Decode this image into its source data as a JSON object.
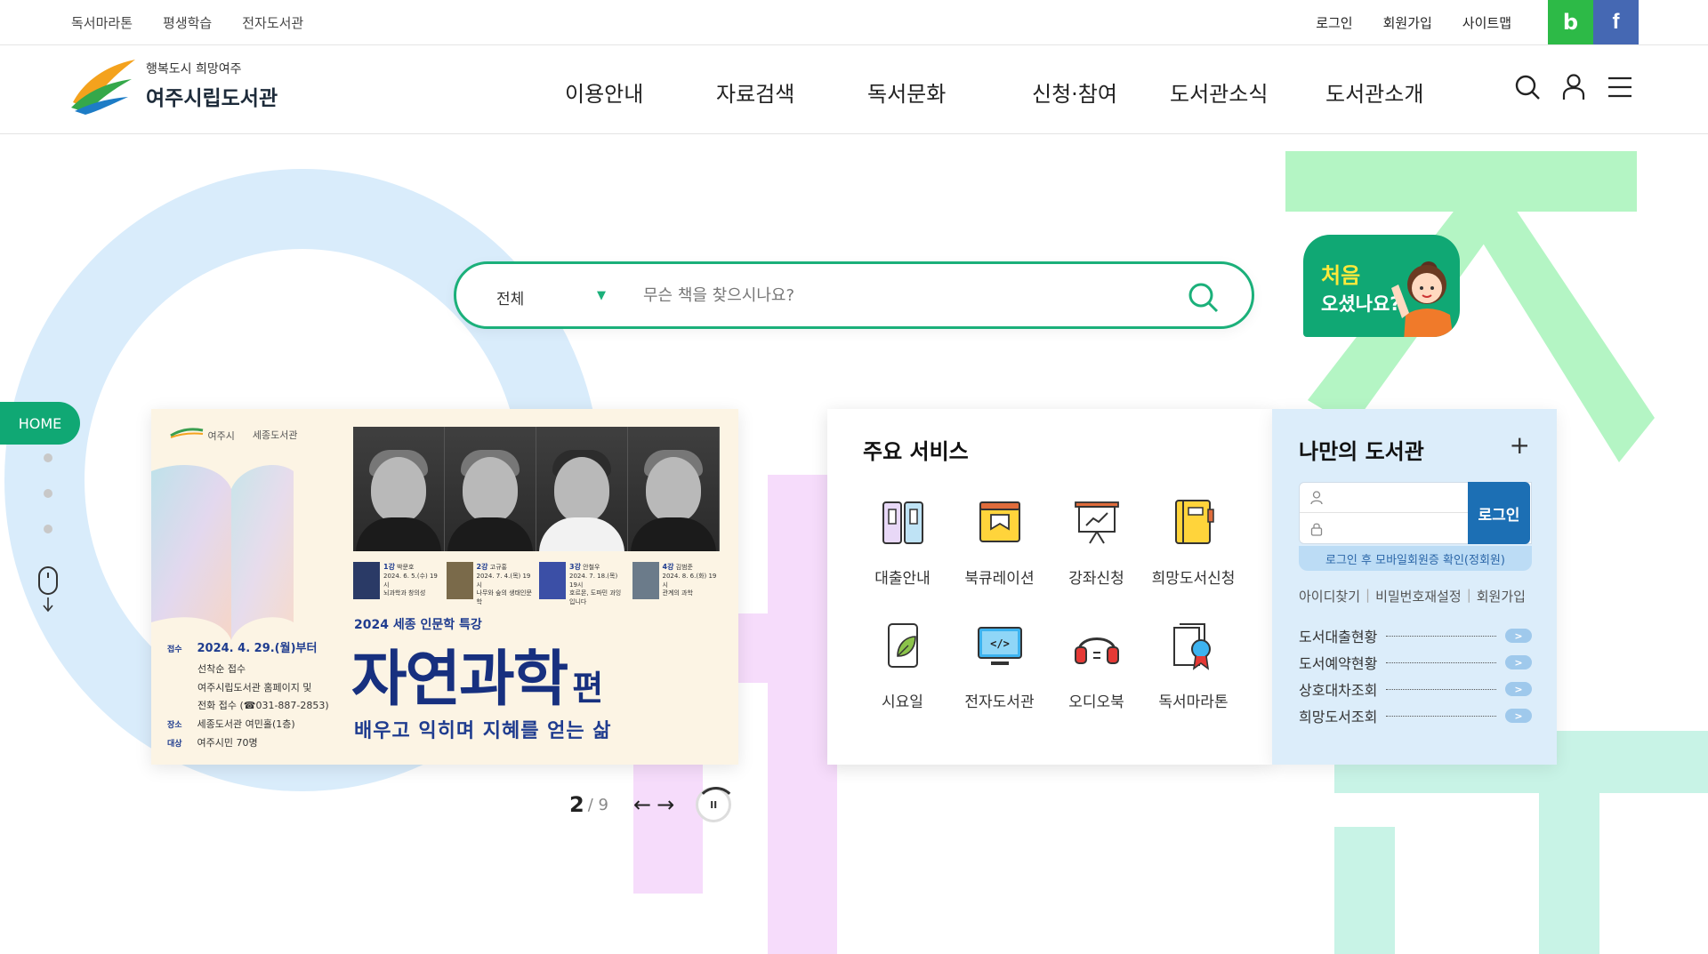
{
  "util": {
    "left_links": [
      "독서마라톤",
      "평생학습",
      "전자도서관"
    ],
    "right_links": [
      "로그인",
      "회원가입",
      "사이트맵"
    ],
    "band_label": "b",
    "facebook_label": "f"
  },
  "logo": {
    "subtitle": "행복도시 희망여주",
    "title": "여주시립도서관"
  },
  "gnb": [
    "이용안내",
    "자료검색",
    "독서문화",
    "신청·참여",
    "도서관소식",
    "도서관소개"
  ],
  "search": {
    "scope": "전체",
    "placeholder": "무슨 책을 찾으시나요?"
  },
  "first_visit": {
    "line1": "처음",
    "line2": "오셨나요?"
  },
  "home_tag": "HOME",
  "banner": {
    "org1": "여주시",
    "org2": "세종도서관",
    "sessions": [
      {
        "num": "1강",
        "name": "박문호",
        "date": "2024. 6. 5.(수) 19시",
        "topic": "뇌과학과 창의성"
      },
      {
        "num": "2강",
        "name": "고규홍",
        "date": "2024. 7. 4.(목) 19시",
        "topic": "나무와 숲의 생태인문학"
      },
      {
        "num": "3강",
        "name": "안철우",
        "date": "2024. 7. 18.(목) 19시",
        "topic": "호르몬, 도파민 과잉입니다"
      },
      {
        "num": "4강",
        "name": "김범준",
        "date": "2024. 8. 6.(화) 19시",
        "topic": "관계의 과학"
      }
    ],
    "info": [
      {
        "label": "접수",
        "value": "2024. 4. 29.(월)부터",
        "line2": "선착순 접수",
        "line3": "여주시립도서관 홈페이지 및",
        "line4": "전화 접수 (☎031-887-2853)"
      },
      {
        "label": "장소",
        "value": "세종도서관 여민홀(1층)"
      },
      {
        "label": "대상",
        "value": "여주시민 70명"
      }
    ],
    "subtitle": "2024 세종 인문학 특강",
    "title": "자연과학",
    "title_suffix": "편",
    "description": "배우고 익히며 지혜를 얻는 삶"
  },
  "pager": {
    "current": "2",
    "total": "/ 9",
    "pause": "II"
  },
  "services": {
    "title": "주요 서비스",
    "items": [
      {
        "label": "대출안내",
        "icon": "loan-guide-icon"
      },
      {
        "label": "북큐레이션",
        "icon": "book-curation-icon"
      },
      {
        "label": "강좌신청",
        "icon": "lecture-icon"
      },
      {
        "label": "희망도서신청",
        "icon": "wish-book-icon"
      },
      {
        "label": "시요일",
        "icon": "poetry-app-icon"
      },
      {
        "label": "전자도서관",
        "icon": "e-library-icon"
      },
      {
        "label": "오디오북",
        "icon": "audiobook-icon"
      },
      {
        "label": "독서마라톤",
        "icon": "reading-marathon-icon"
      }
    ]
  },
  "mylib": {
    "title": "나만의 도서관",
    "login_label": "로그인",
    "mobile_note": "로그인 후 모바일회원증 확인(정회원)",
    "find_id": "아이디찾기",
    "reset_pw": "비밀번호재설정",
    "join": "회원가입",
    "stats": [
      "도서대출현황",
      "도서예약현황",
      "상호대차조회",
      "희망도서조회"
    ],
    "go_label": ">"
  },
  "colors": {
    "brand_green": "#10a874",
    "search_border": "#1bb07a",
    "login_blue": "#1c6fb4",
    "mylib_bg": "#dcedfa"
  }
}
